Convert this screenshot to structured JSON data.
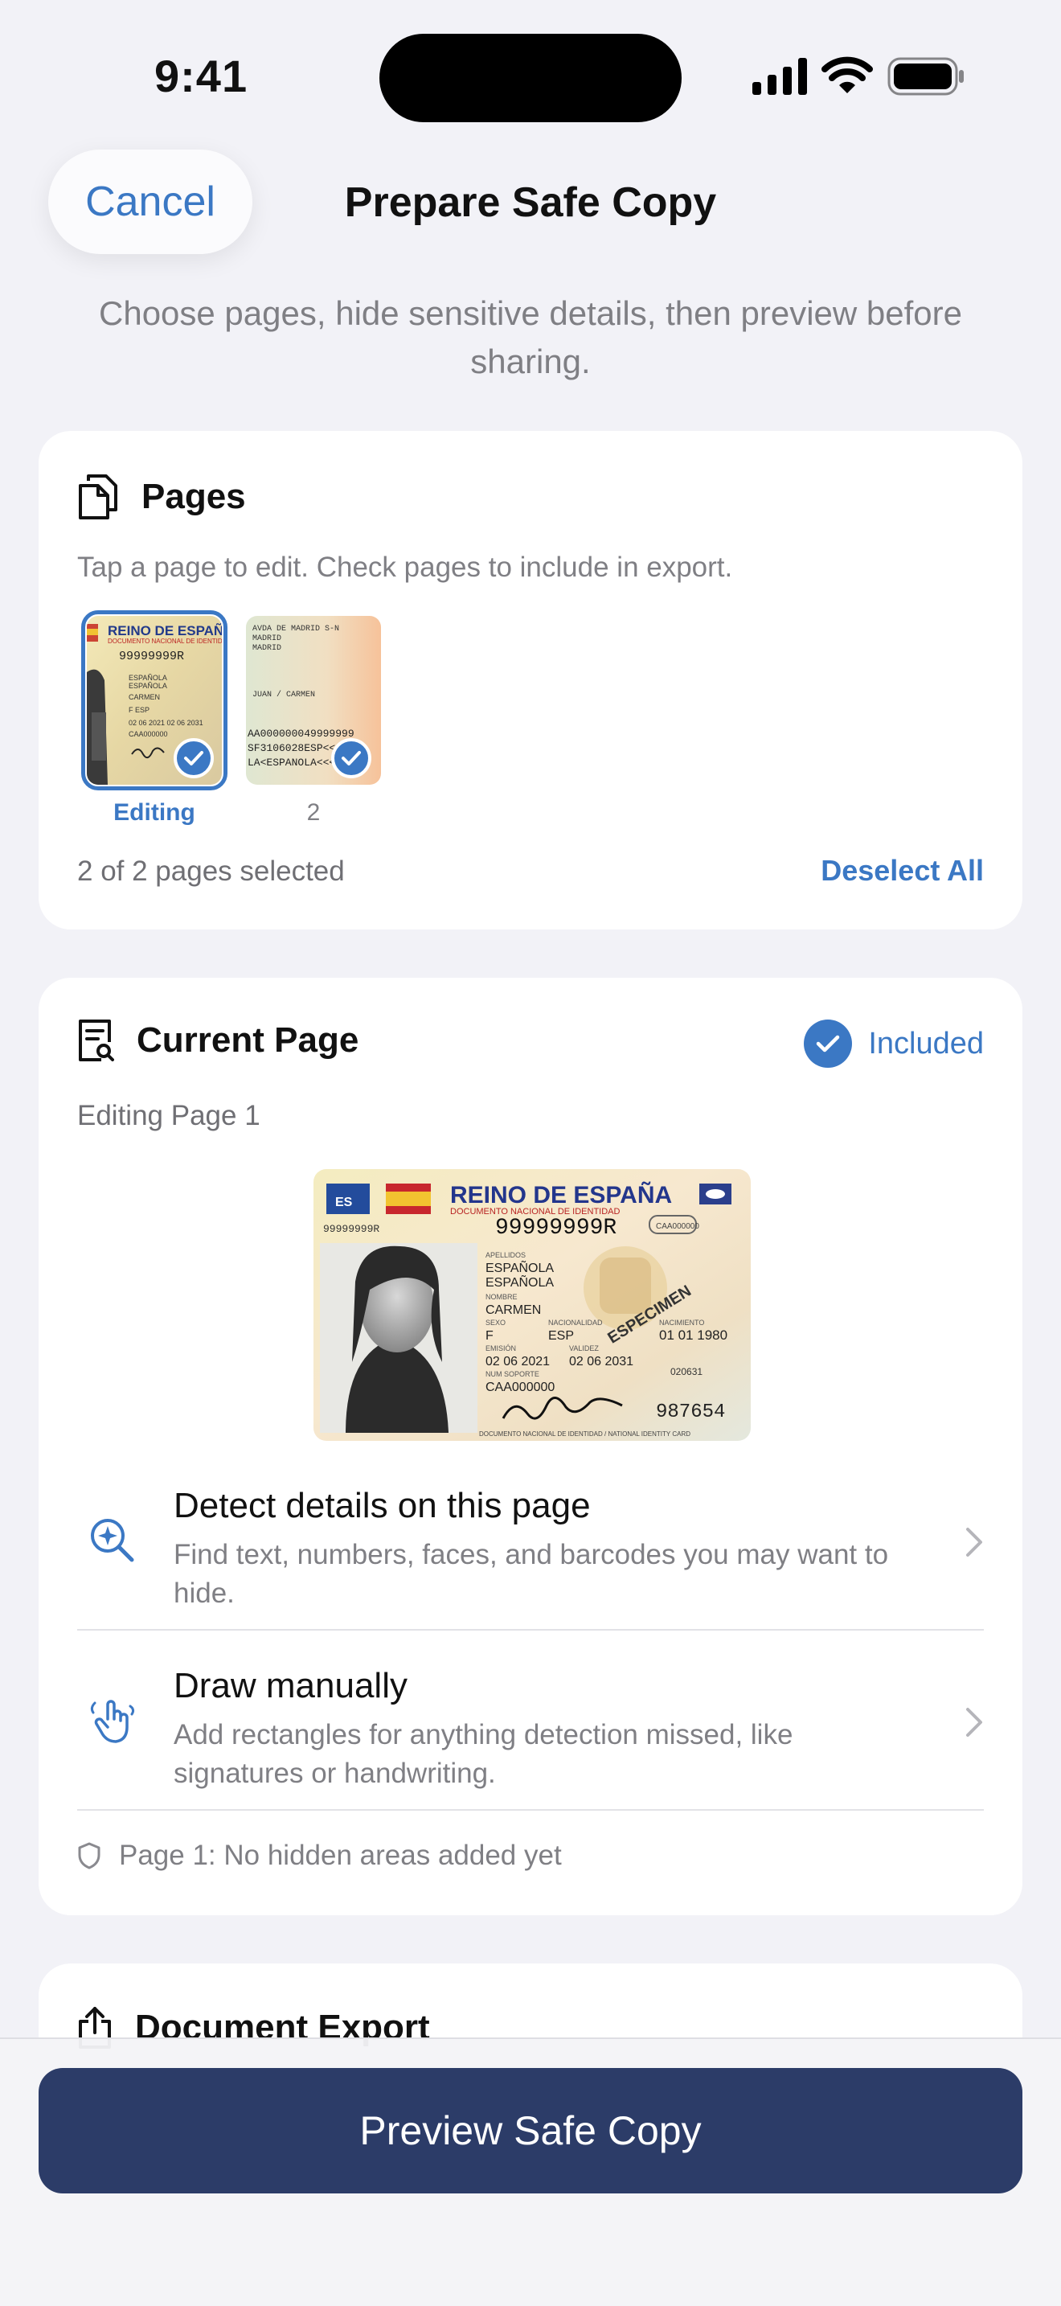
{
  "status": {
    "time": "9:41"
  },
  "nav": {
    "cancel_label": "Cancel",
    "title": "Prepare Safe Copy"
  },
  "subtitle": "Choose pages, hide sensitive details, then preview before sharing.",
  "pages": {
    "title": "Pages",
    "hint": "Tap a page to edit. Check pages to include in export.",
    "thumbnails": [
      {
        "label": "Editing",
        "selected": true,
        "checked": true
      },
      {
        "label": "2",
        "selected": false,
        "checked": true
      }
    ],
    "selection_count": "2 of 2 pages selected",
    "deselect_label": "Deselect All"
  },
  "current_page": {
    "title": "Current Page",
    "included_label": "Included",
    "editing_label": "Editing Page 1",
    "id_card": {
      "country": "REINO DE ESPAÑA",
      "doc_line": "DOCUMENTO NACIONAL DE IDENTIDAD",
      "code": "ES",
      "dni": "99999999R",
      "surname1": "ESPAÑOLA",
      "surname2": "ESPAÑOLA",
      "name": "CARMEN",
      "sex": "F",
      "nationality": "ESP",
      "birth": "01 01 1980",
      "issue": "02 06 2021",
      "expiry": "02 06 2031",
      "support": "CAA000000",
      "number": "987654",
      "specimen": "ESPECIMEN",
      "footer": "DOCUMENTO NACIONAL DE IDENTIDAD / NATIONAL IDENTITY CARD"
    },
    "actions": [
      {
        "title": "Detect details on this page",
        "desc": "Find text, numbers, faces, and barcodes you may want to hide."
      },
      {
        "title": "Draw manually",
        "desc": "Add rectangles for anything detection missed, like signatures or handwriting."
      }
    ],
    "status": "Page 1: No hidden areas added yet"
  },
  "export": {
    "title": "Document Export"
  },
  "footer": {
    "preview_label": "Preview Safe Copy"
  },
  "colors": {
    "accent": "#3b78c4",
    "primary_button": "#2c3c68",
    "background": "#f2f2f7"
  }
}
